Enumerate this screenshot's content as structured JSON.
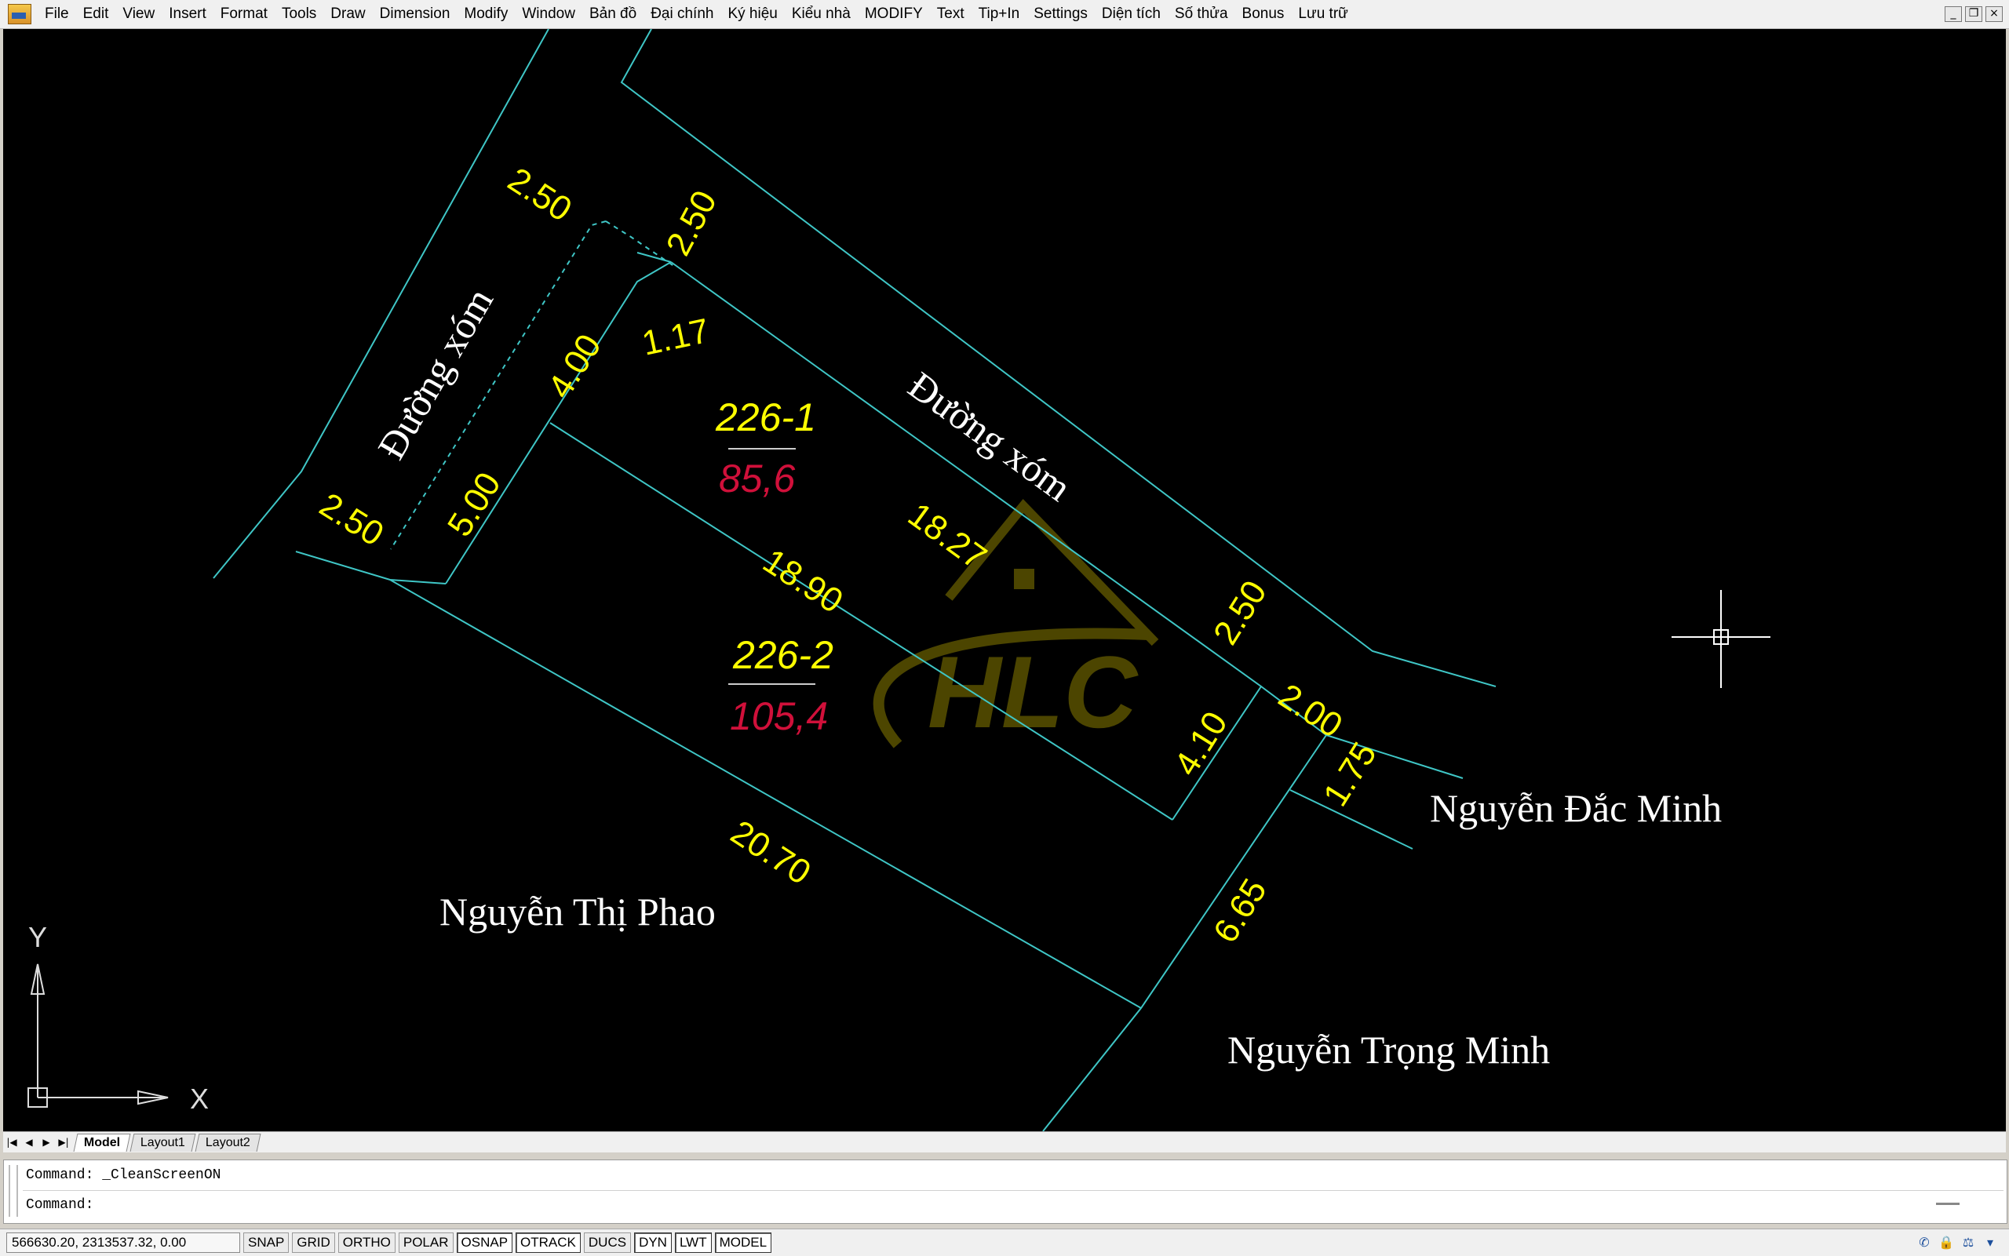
{
  "menubar": {
    "items": [
      "File",
      "Edit",
      "View",
      "Insert",
      "Format",
      "Tools",
      "Draw",
      "Dimension",
      "Modify",
      "Window",
      "Bản đồ",
      "Đại chính",
      "Ký hiệu",
      "Kiểu nhà",
      "MODIFY",
      "Text",
      "Tip+In",
      "Settings",
      "Diện tích",
      "Số thửa",
      "Bonus",
      "Lưu trữ"
    ],
    "window_controls": [
      "_",
      "❐",
      "×"
    ]
  },
  "drawing": {
    "labels": {
      "road_left": "Đường xóm",
      "road_top": "Đường xóm",
      "neighbor_bottom_left": "Nguyễn Thị Phao",
      "neighbor_right": "Nguyễn Đắc Minh",
      "neighbor_bottom_right": "Nguyễn Trọng Minh"
    },
    "parcels": [
      {
        "id": "226-1",
        "area": "85,6"
      },
      {
        "id": "226-2",
        "area": "105,4"
      }
    ],
    "dimensions": {
      "d_250_a": "2.50",
      "d_250_b": "2.50",
      "d_250_c": "2.50",
      "d_250_d": "2.50",
      "d_400": "4.00",
      "d_117": "1.17",
      "d_500": "5.00",
      "d_1827": "18.27",
      "d_1890": "18.90",
      "d_2070": "20.70",
      "d_200": "2.00",
      "d_410": "4.10",
      "d_175": "1.75",
      "d_665": "6.65"
    },
    "watermark": "HLC",
    "ucs": {
      "x": "X",
      "y": "Y"
    },
    "colors": {
      "background": "#000000",
      "lines": "#3fc6c6",
      "dimension_text": "#ffff00",
      "area_text": "#d0103a",
      "name_text": "#ffffff",
      "watermark": "#5a5200"
    }
  },
  "tabs": {
    "nav": [
      "|◀",
      "◀",
      "▶",
      "▶|"
    ],
    "items": [
      "Model",
      "Layout1",
      "Layout2"
    ]
  },
  "command": {
    "history": "Command: _CleanScreenON",
    "prompt": "Command:"
  },
  "status": {
    "coords": "566630.20, 2313537.32, 0.00",
    "buttons": [
      "SNAP",
      "GRID",
      "ORTHO",
      "POLAR",
      "OSNAP",
      "OTRACK",
      "DUCS",
      "DYN",
      "LWT",
      "MODEL"
    ],
    "active": [
      "OSNAP",
      "OTRACK",
      "DYN",
      "LWT",
      "MODEL"
    ]
  }
}
